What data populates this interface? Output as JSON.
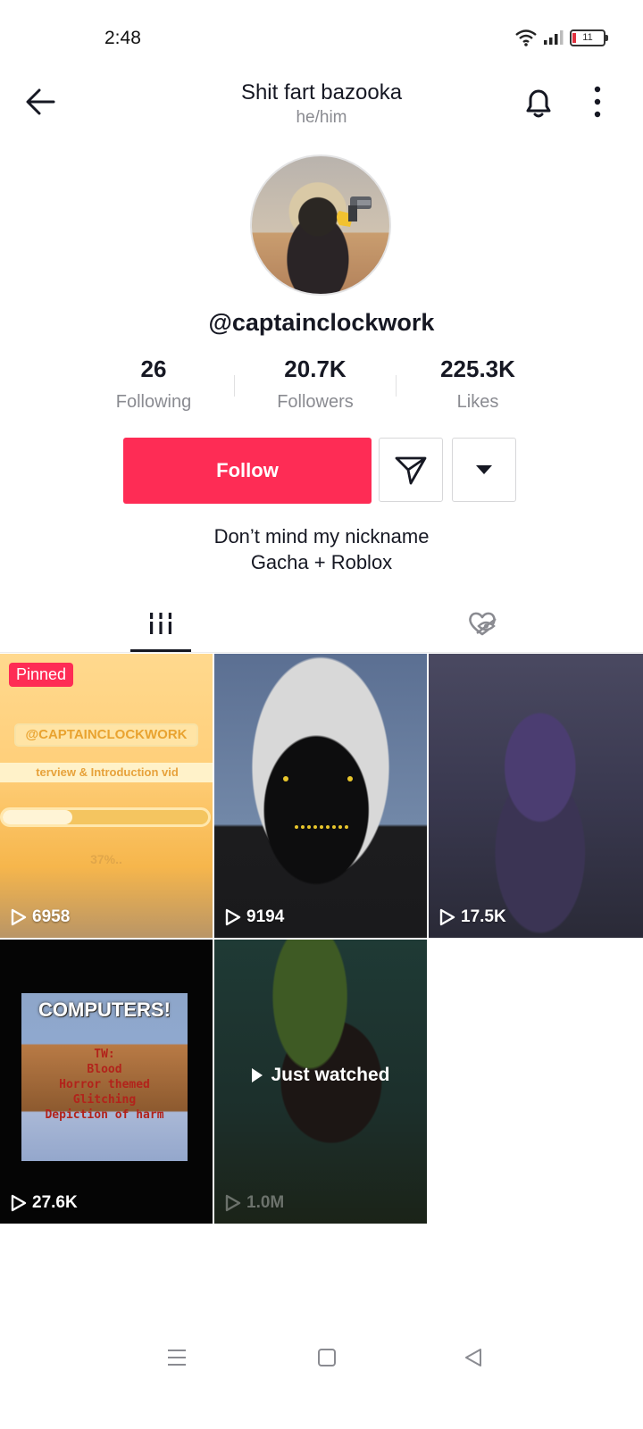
{
  "status_bar": {
    "time": "2:48",
    "battery": "11"
  },
  "header": {
    "title": "Shit fart bazooka",
    "pronouns": "he/him"
  },
  "profile": {
    "username": "@captainclockwork",
    "stats": [
      {
        "value": "26",
        "label": "Following"
      },
      {
        "value": "20.7K",
        "label": "Followers"
      },
      {
        "value": "225.3K",
        "label": "Likes"
      }
    ],
    "follow_label": "Follow",
    "bio": [
      "Don’t mind my nickname",
      "Gacha + Roblox"
    ]
  },
  "videos": [
    {
      "views": "6958",
      "pinned_label": "Pinned",
      "overlay": {
        "handle": "@CAPTAINCLOCKWORK",
        "subtitle": "terview & Introduction vid",
        "progress": "37%.."
      }
    },
    {
      "views": "9194"
    },
    {
      "views": "17.5K"
    },
    {
      "views": "27.6K",
      "overlay": {
        "title": "COMPUTERS!",
        "warning": [
          "TW:",
          "Blood",
          "Horror themed",
          "Glitching",
          "Depiction of harm"
        ]
      }
    },
    {
      "views": "1.0M",
      "just_watched_label": "Just watched"
    }
  ],
  "colors": {
    "accent": "#fe2c55",
    "text": "#161823",
    "muted": "#8a8b91"
  }
}
